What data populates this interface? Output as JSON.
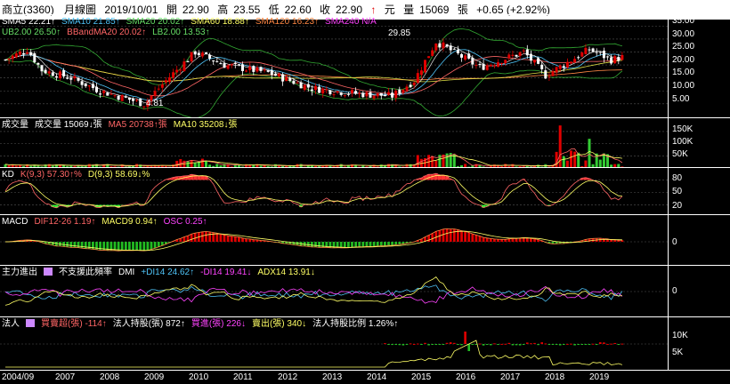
{
  "header": {
    "stock": "商立(3360)",
    "period": "月線圖",
    "date": "2019/10/01",
    "open_label": "開",
    "open": "22.90",
    "high_label": "高",
    "high": "23.55",
    "low_label": "低",
    "low": "22.60",
    "close_label": "收",
    "close": "22.90",
    "arrow": "↑",
    "unit": "元",
    "vol_label": "量",
    "volume": "15069",
    "vol_unit": "張",
    "change": "+0.65 (+2.92%)"
  },
  "price_panel": {
    "legend_row1": [
      {
        "text": "SMA5 22.21↑",
        "color": "#ffffff"
      },
      {
        "text": "SMA10 21.85↑",
        "color": "#4fc3f7"
      },
      {
        "text": "SMA20 20.02↑",
        "color": "#66dd66"
      },
      {
        "text": "SMA60 18.88↑",
        "color": "#ffff66"
      },
      {
        "text": "SMA120 16.23↑",
        "color": "#ff8844"
      },
      {
        "text": "SMA240 N/A",
        "color": "#ff44ff"
      }
    ],
    "legend_row2": [
      {
        "text": "UB2.00 26.50↑",
        "color": "#66dd66"
      },
      {
        "text": "BBandMA20 20.02↑",
        "color": "#ff6666"
      },
      {
        "text": "LB2.00 13.53↑",
        "color": "#66dd66"
      }
    ],
    "annotations": {
      "high": "29.85",
      "low": "4.81"
    },
    "y_ticks": [
      "35.00",
      "30.00",
      "25.00",
      "20.00",
      "15.00",
      "10.00",
      "5.00"
    ],
    "ylim": [
      0,
      36.5
    ]
  },
  "volume_panel": {
    "legend": [
      {
        "text": "成交量",
        "color": "#ffffff"
      },
      {
        "text": "成交量 15069↓張",
        "color": "#ffffff"
      },
      {
        "text": "MA5 20738↑張",
        "color": "#ff6666"
      },
      {
        "text": "MA10 35208↓張",
        "color": "#ffff66"
      }
    ],
    "y_ticks": [
      "150K",
      "100K",
      "50K"
    ],
    "ylim": [
      0,
      190000
    ]
  },
  "kd_panel": {
    "legend": [
      {
        "text": "KD",
        "color": "#ffffff"
      },
      {
        "text": "K(9,3) 57.30↑%",
        "color": "#ff6666"
      },
      {
        "text": "D(9,3) 58.69↓%",
        "color": "#ffff66"
      }
    ],
    "y_ticks": [
      "80",
      "50",
      "20"
    ],
    "ylim": [
      0,
      100
    ]
  },
  "macd_panel": {
    "legend": [
      {
        "text": "MACD",
        "color": "#ffffff"
      },
      {
        "text": "DIF12-26 1.19↑",
        "color": "#ff6666"
      },
      {
        "text": "MACD9 0.94↑",
        "color": "#ffff66"
      },
      {
        "text": "OSC 0.25↑",
        "color": "#ff44ff"
      }
    ],
    "y_ticks": [
      "0"
    ]
  },
  "dmi_panel": {
    "legend": [
      {
        "text": "主力進出",
        "color": "#ffffff"
      },
      {
        "text": "不支援此頻率",
        "color": "#ffffff"
      },
      {
        "text": "DMI",
        "color": "#ffffff"
      },
      {
        "text": "+DI14 24.62↑",
        "color": "#4fc3f7"
      },
      {
        "text": "-DI14 19.41↓",
        "color": "#ff44ff"
      },
      {
        "text": "ADX14 13.91↓",
        "color": "#ffff66"
      }
    ],
    "y_ticks": [
      "0"
    ]
  },
  "inst_panel": {
    "legend": [
      {
        "text": "法人",
        "color": "#ffffff"
      },
      {
        "text": "買賣超(張) -114↑",
        "color": "#ff6666"
      },
      {
        "text": "法人持股(張) 872↑",
        "color": "#ffffff"
      },
      {
        "text": "買進(張) 226↓",
        "color": "#ff44ff"
      },
      {
        "text": "賣出(張) 340↓",
        "color": "#ffff66"
      },
      {
        "text": "法人持股比例 1.26%↑",
        "color": "#ffffff"
      }
    ],
    "y_ticks": [
      "10K",
      "5K"
    ]
  },
  "x_axis": [
    "2004/09",
    "2007",
    "2008",
    "2009",
    "2010",
    "2011",
    "2012",
    "2013",
    "2014",
    "2015",
    "2016",
    "2017",
    "2018",
    "2019"
  ],
  "colors": {
    "up": "#e00000",
    "down": "#ffffff",
    "vol_up": "#e00000",
    "vol_down": "#33cc33",
    "grid": "#555555"
  }
}
